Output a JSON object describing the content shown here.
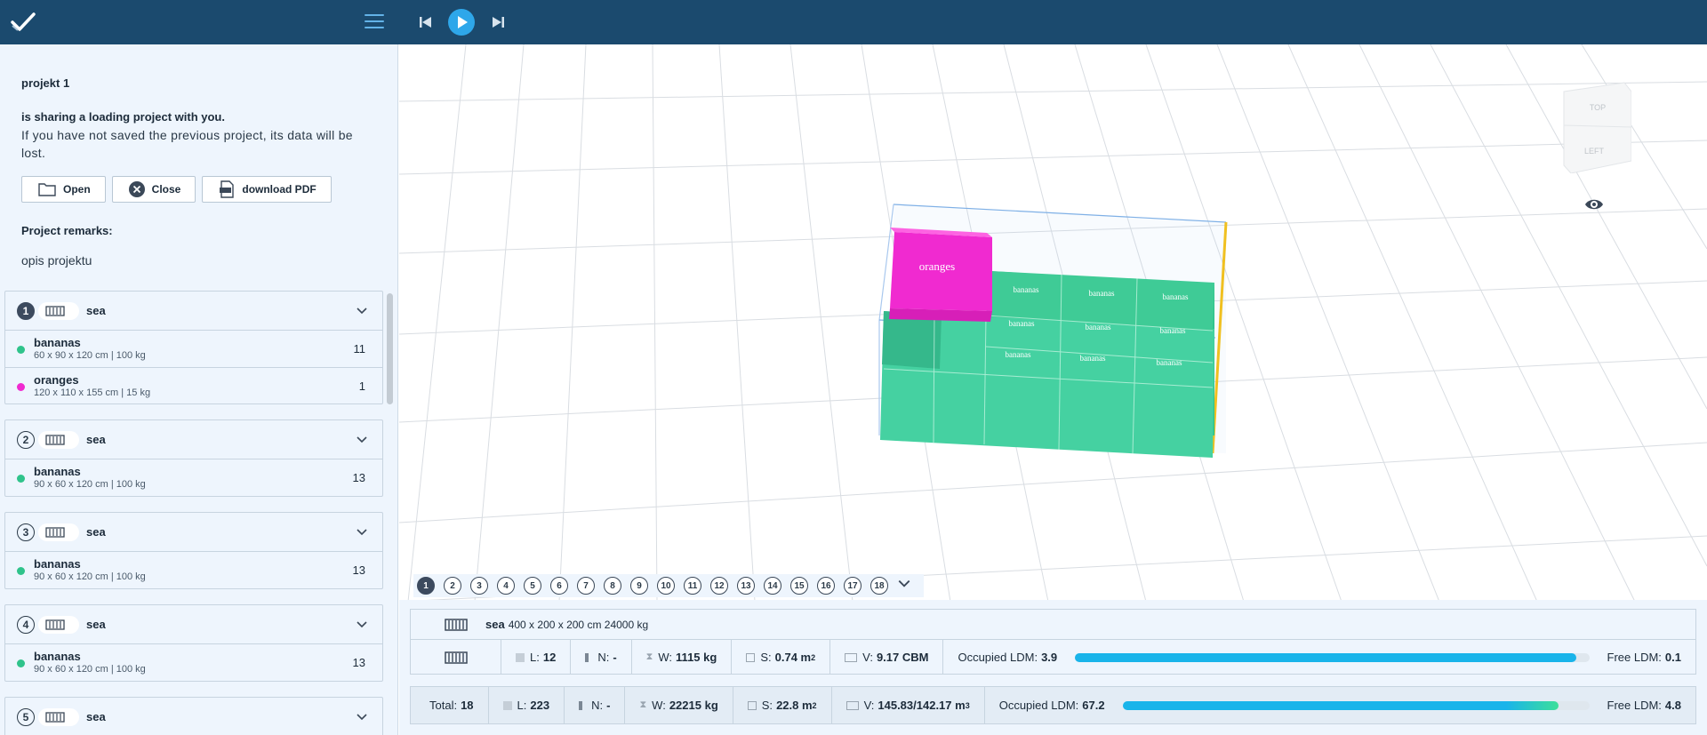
{
  "app": {
    "logo_icon": "checkmark-logo-icon",
    "menu_icon": "hamburger-menu-icon"
  },
  "player": {
    "prev_icon": "skip-previous-icon",
    "play_icon": "play-icon",
    "next_icon": "skip-next-icon"
  },
  "notice": {
    "project_name": "projekt 1",
    "sharing_text": "is sharing a loading project with you.",
    "warning_text": "If you have not saved the previous project, its data will be lost.",
    "buttons": {
      "open": "Open",
      "close": "Close",
      "pdf": "download PDF"
    },
    "remarks_label": "Project remarks:",
    "remarks_value": "opis projektu"
  },
  "containers": [
    {
      "num": "1",
      "name": "sea",
      "active": true,
      "items": [
        {
          "name": "bananas",
          "dims": "60 x 90 x 120 cm | 100 kg",
          "qty": "11",
          "color": "#2fc38b"
        },
        {
          "name": "oranges",
          "dims": "120 x 110 x 155 cm | 15 kg",
          "qty": "1",
          "color": "#f02ad0"
        }
      ]
    },
    {
      "num": "2",
      "name": "sea",
      "active": false,
      "items": [
        {
          "name": "bananas",
          "dims": "90 x 60 x 120 cm | 100 kg",
          "qty": "13",
          "color": "#2fc38b"
        }
      ]
    },
    {
      "num": "3",
      "name": "sea",
      "active": false,
      "items": [
        {
          "name": "bananas",
          "dims": "90 x 60 x 120 cm | 100 kg",
          "qty": "13",
          "color": "#2fc38b"
        }
      ]
    },
    {
      "num": "4",
      "name": "sea",
      "active": false,
      "items": [
        {
          "name": "bananas",
          "dims": "90 x 60 x 120 cm | 100 kg",
          "qty": "13",
          "color": "#2fc38b"
        }
      ]
    },
    {
      "num": "5",
      "name": "sea",
      "active": false,
      "items": []
    }
  ],
  "scene": {
    "box_label_big": "oranges",
    "box_label_small": "bananas",
    "cube_top": "TOP",
    "cube_left": "LEFT",
    "eye_icon": "eye-visibility-icon"
  },
  "pages": [
    "1",
    "2",
    "3",
    "4",
    "5",
    "6",
    "7",
    "8",
    "9",
    "10",
    "11",
    "12",
    "13",
    "14",
    "15",
    "16",
    "17",
    "18"
  ],
  "current_container": {
    "name": "sea",
    "dims": "400 x 200 x 200 cm 24000 kg",
    "l_label": "L:",
    "l_value": "12",
    "n_label": "N:",
    "n_value": "-",
    "w_label": "W:",
    "w_value": "1115 kg",
    "s_label": "S:",
    "s_value": "0.74 m",
    "v_label": "V:",
    "v_value": "9.17 CBM",
    "occupied_label": "Occupied LDM:",
    "occupied_value": "3.9",
    "free_label": "Free LDM:",
    "free_value": "0.1",
    "ldm_fill": 0.975
  },
  "totals": {
    "total_label": "Total:",
    "total_value": "18",
    "l_label": "L:",
    "l_value": "223",
    "n_label": "N:",
    "n_value": "-",
    "w_label": "W:",
    "w_value": "22215 kg",
    "s_label": "S:",
    "s_value": "22.8 m",
    "v_label": "V:",
    "v_value": "145.83/142.17 m",
    "occupied_label": "Occupied LDM:",
    "occupied_value": "67.2",
    "free_label": "Free LDM:",
    "free_value": "4.8",
    "ldm_fill": 0.934
  }
}
